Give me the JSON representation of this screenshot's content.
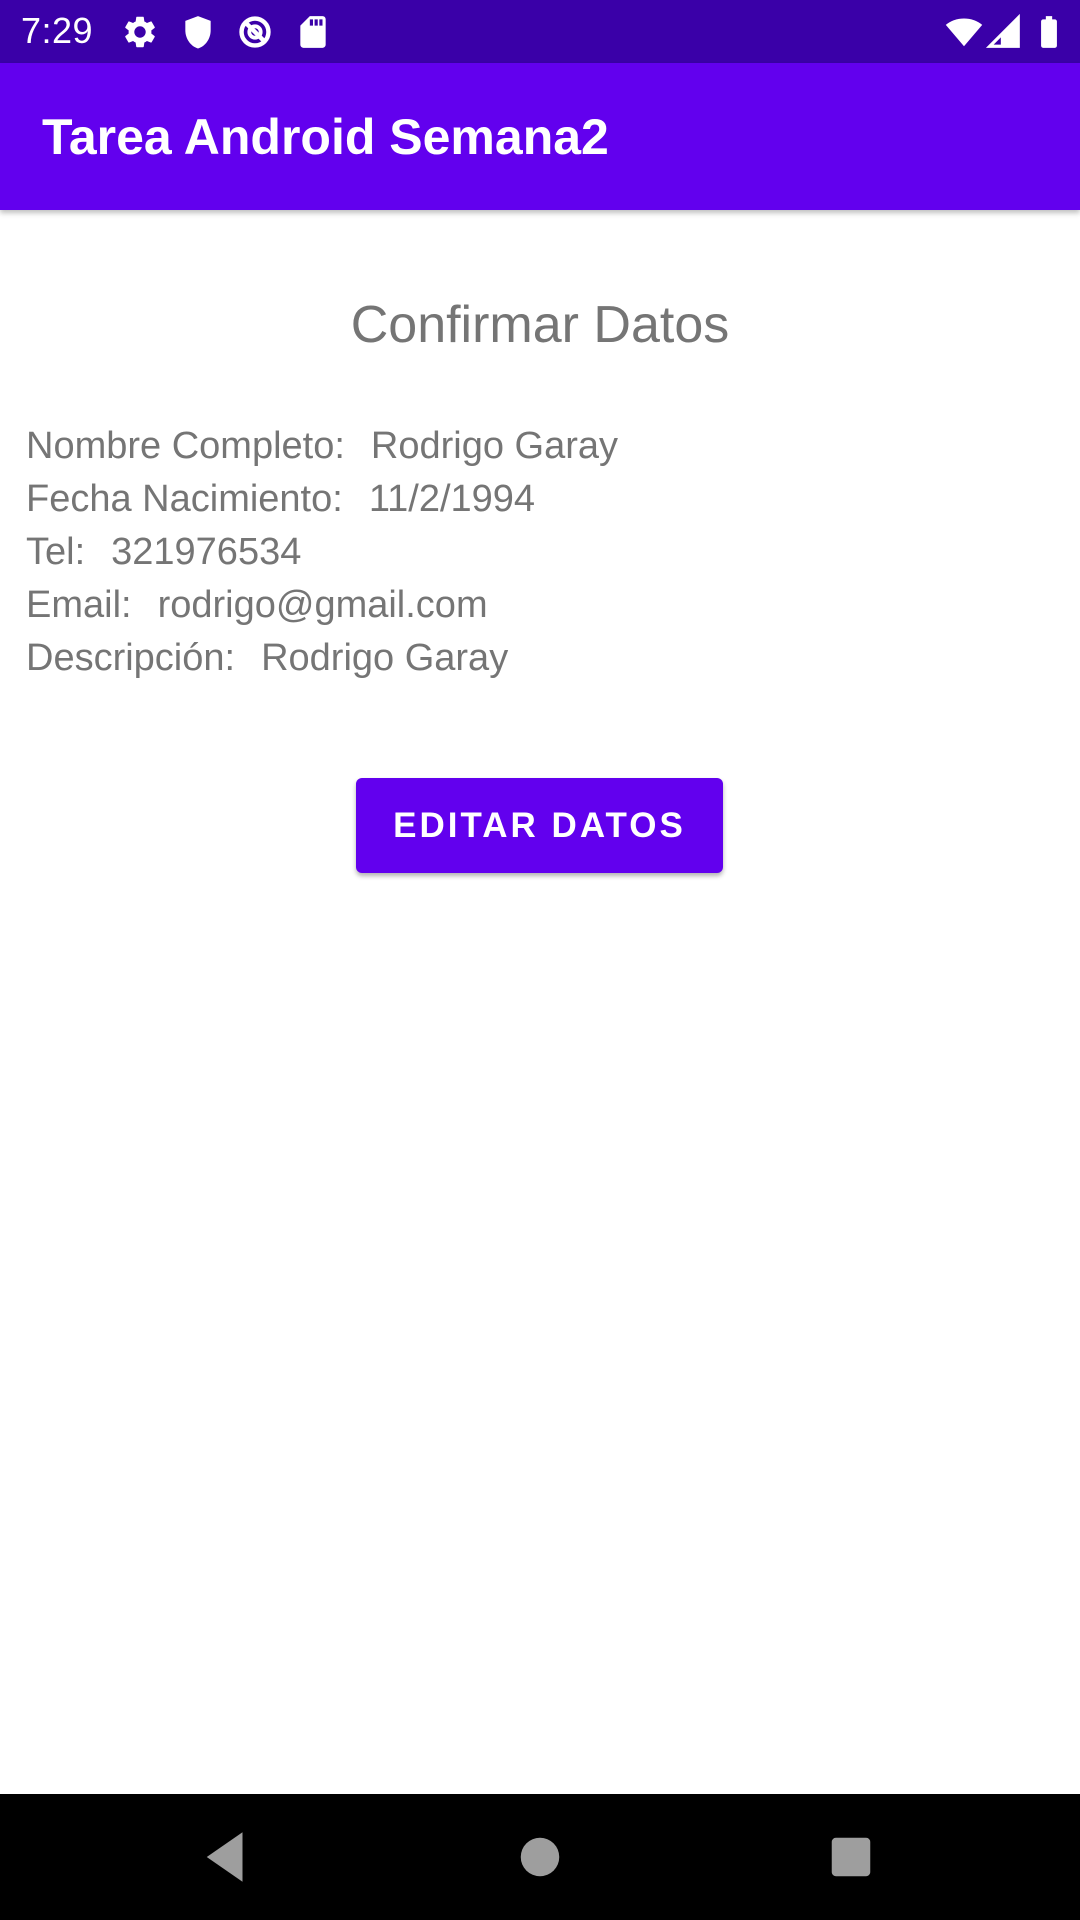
{
  "status_bar": {
    "time": "7:29",
    "icons": [
      "gear-icon",
      "shield-icon",
      "data-saver-icon",
      "sd-card-icon",
      "wifi-icon",
      "signal-icon",
      "battery-icon"
    ]
  },
  "app_bar": {
    "title": "Tarea Android Semana2",
    "color": "#6200ee"
  },
  "screen": {
    "title": "Confirmar Datos",
    "fields": [
      {
        "label": "Nombre Completo:",
        "value": "Rodrigo Garay"
      },
      {
        "label": "Fecha Nacimiento:",
        "value": "11/2/1994"
      },
      {
        "label": "Tel:",
        "value": "321976534"
      },
      {
        "label": "Email:",
        "value": "rodrigo@gmail.com"
      },
      {
        "label": "Descripción:",
        "value": "Rodrigo Garay"
      }
    ],
    "button_label": "EDITAR DATOS"
  },
  "nav_bar": {
    "icons": [
      "back-icon",
      "home-icon",
      "recents-icon"
    ]
  },
  "colors": {
    "status_bar": "#3a00a8",
    "primary": "#6200ee",
    "text_secondary": "#757575"
  }
}
